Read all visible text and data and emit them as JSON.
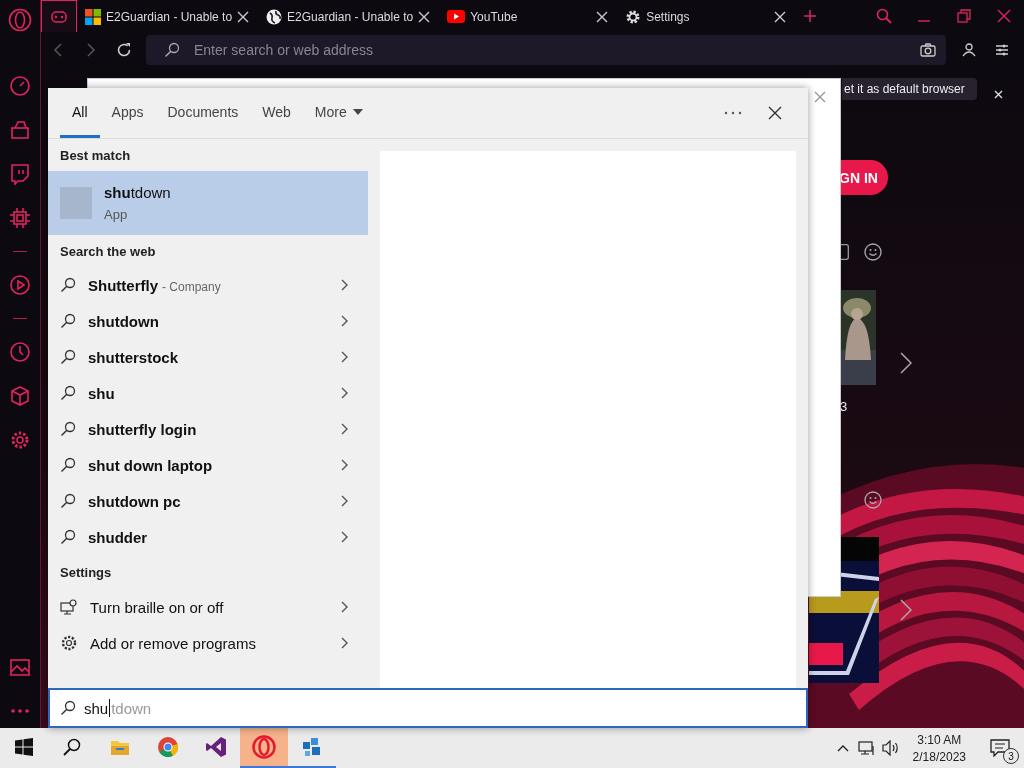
{
  "browser": {
    "tabs": [
      {
        "kind": "gamepad",
        "selected": true
      },
      {
        "kind": "windows",
        "title": "E2Guardian - Unable to",
        "selected": false
      },
      {
        "kind": "globe",
        "title": "E2Guardian - Unable to",
        "selected": false
      },
      {
        "kind": "youtube",
        "title": "YouTube",
        "selected": false
      },
      {
        "kind": "gear",
        "title": "Settings",
        "selected": false
      }
    ],
    "address": {
      "placeholder": "Enter search or web address"
    },
    "page": {
      "banner": "et it as default browser",
      "sign_in": "GN IN",
      "count": "3"
    }
  },
  "start_menu": {
    "tabs": [
      {
        "label": "All",
        "selected": true
      },
      {
        "label": "Apps",
        "selected": false
      },
      {
        "label": "Documents",
        "selected": false
      },
      {
        "label": "Web",
        "selected": false
      },
      {
        "label": "More",
        "selected": false,
        "kind": "dropdown"
      }
    ],
    "best_match": {
      "header": "Best match",
      "title": "**shu**tdown",
      "type": "App"
    },
    "web": {
      "header": "Search the web",
      "items": [
        {
          "text": "Shutterfly",
          "note": "- Company"
        },
        {
          "text": "shutdown"
        },
        {
          "text": "shutterstock"
        },
        {
          "text": "shu"
        },
        {
          "text": "shutterfly login"
        },
        {
          "text": "shut down laptop"
        },
        {
          "text": "shutdown pc"
        },
        {
          "text": "shudder"
        }
      ]
    },
    "settings": {
      "header": "Settings",
      "items": [
        {
          "kind": "braille",
          "text": "Turn braille on or off"
        },
        {
          "kind": "gear",
          "text": "Add or remove programs"
        }
      ]
    },
    "search": {
      "value": "shu",
      "completion": "tdown"
    }
  },
  "taskbar": {
    "apps": [
      {
        "kind": "explorer",
        "running": false,
        "selected": false
      },
      {
        "kind": "chrome",
        "running": false,
        "selected": false
      },
      {
        "kind": "studio",
        "running": false,
        "selected": false
      },
      {
        "kind": "opera",
        "running": true,
        "selected": true
      },
      {
        "kind": "cube",
        "running": true,
        "selected": false
      }
    ],
    "time": "3:10 AM",
    "date": "2/18/2023",
    "notifications": "3"
  }
}
